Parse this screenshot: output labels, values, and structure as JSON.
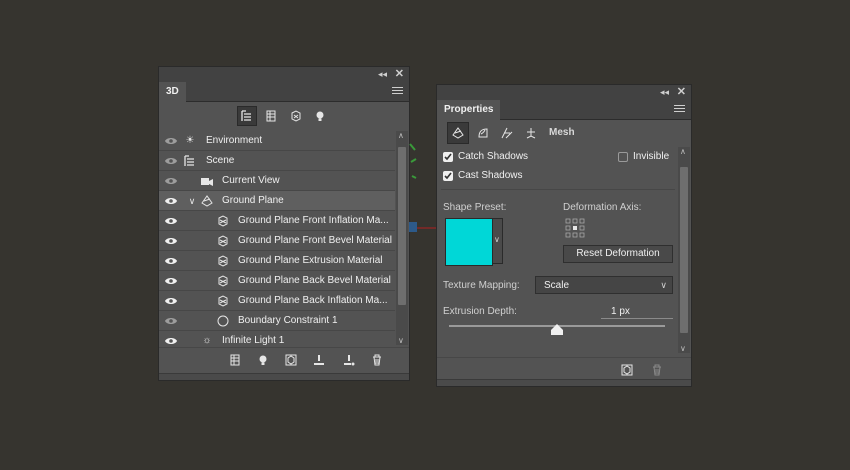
{
  "panel3d": {
    "tab": "3D",
    "filters": [
      {
        "icon": "scene-filter-icon",
        "selected": true
      },
      {
        "icon": "mesh-filter-icon",
        "selected": false
      },
      {
        "icon": "material-filter-icon",
        "selected": false
      },
      {
        "icon": "light-filter-icon",
        "selected": false
      }
    ],
    "rows": [
      {
        "label": "Environment",
        "icon": "environment-icon",
        "visible": true
      },
      {
        "label": "Scene",
        "icon": "scene-icon",
        "visible": true
      },
      {
        "label": "Current View",
        "icon": "camera-icon",
        "visible": true
      },
      {
        "label": "Ground Plane",
        "icon": "mesh-icon",
        "visible": true,
        "selected": true
      },
      {
        "label": "Ground Plane Front Inflation Ma...",
        "icon": "material-icon",
        "visible": true
      },
      {
        "label": "Ground Plane Front Bevel Material",
        "icon": "material-icon",
        "visible": true
      },
      {
        "label": "Ground Plane Extrusion Material",
        "icon": "material-icon",
        "visible": true
      },
      {
        "label": "Ground Plane Back Bevel Material",
        "icon": "material-icon",
        "visible": true
      },
      {
        "label": "Ground Plane Back Inflation Ma...",
        "icon": "material-icon",
        "visible": true
      },
      {
        "label": "Boundary Constraint 1",
        "icon": "constraint-icon",
        "visible": true
      },
      {
        "label": "Infinite Light 1",
        "icon": "infinite-light-icon",
        "visible": true
      }
    ],
    "bottom_buttons": [
      "add-mesh-icon",
      "add-light-icon",
      "render-icon",
      "drop-to-ground-icon",
      "add-constraint-icon",
      "trash-icon"
    ]
  },
  "properties": {
    "tab": "Properties",
    "tool_icons": [
      "mesh-icon",
      "deform-icon",
      "cap-icon",
      "coordinates-icon"
    ],
    "section_label": "Mesh",
    "catch_shadows": {
      "label": "Catch Shadows",
      "checked": true
    },
    "invisible": {
      "label": "Invisible",
      "checked": false
    },
    "cast_shadows": {
      "label": "Cast Shadows",
      "checked": true
    },
    "shape_preset_label": "Shape Preset:",
    "deformation_axis_label": "Deformation Axis:",
    "reset_deformation": "Reset Deformation",
    "texture_mapping_label": "Texture Mapping:",
    "texture_mapping_value": "Scale",
    "extrusion_depth_label": "Extrusion Depth:",
    "extrusion_depth_value": "1 px",
    "preset_color": "#00d7d7"
  }
}
